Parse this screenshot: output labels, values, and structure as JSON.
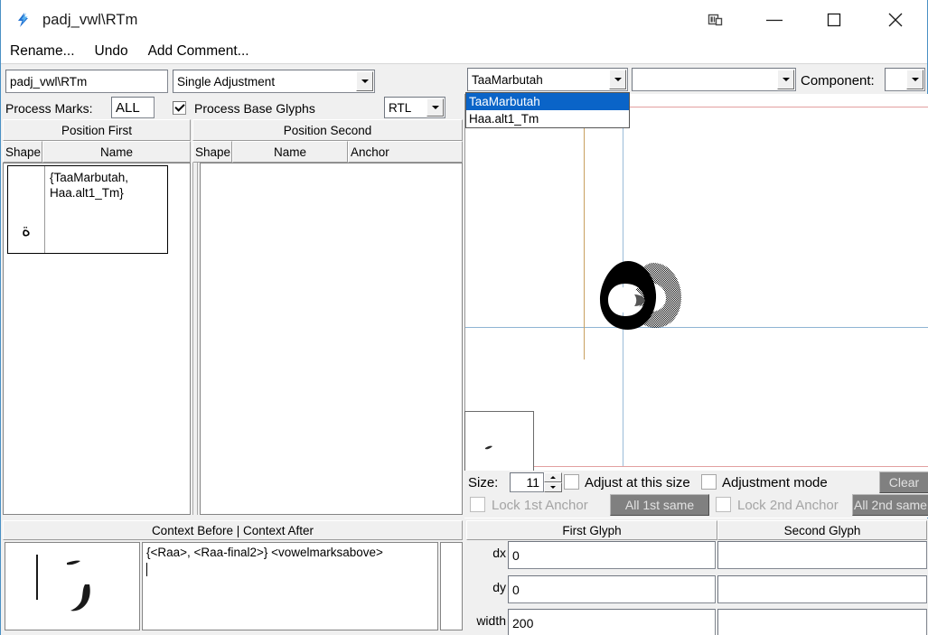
{
  "window": {
    "title": "padj_vwl\\RTm",
    "app_icon": "lightning-bolt-icon",
    "controls": {
      "restore_small": "window-restore-icon",
      "minimize": "—",
      "maximize": "□",
      "close": "✕"
    }
  },
  "menubar": {
    "items": [
      {
        "label": "Rename..."
      },
      {
        "label": "Undo"
      },
      {
        "label": "Add Comment..."
      }
    ]
  },
  "toolbar": {
    "lookup_name": "padj_vwl\\RTm",
    "adjustment_type": "Single Adjustment",
    "process_marks_label": "Process Marks:",
    "process_marks_value": "ALL",
    "process_base_glyphs_label": "Process Base Glyphs",
    "process_base_glyphs_checked": true,
    "direction": "RTL",
    "glyph_combo_value": "TaaMarbutah",
    "second_combo_value": "",
    "component_label": "Component:",
    "component_value": ""
  },
  "dropdown": {
    "open": true,
    "items": [
      {
        "label": "TaaMarbutah",
        "selected": true
      },
      {
        "label": "Haa.alt1_Tm",
        "selected": false
      }
    ]
  },
  "table": {
    "group_headers": [
      {
        "label": "Position First"
      },
      {
        "label": "Position Second"
      }
    ],
    "columns_first": [
      {
        "label": "Shape"
      },
      {
        "label": "Name"
      }
    ],
    "columns_second": [
      {
        "label": "Shape"
      },
      {
        "label": "Name"
      },
      {
        "label": "Anchor"
      }
    ],
    "rows_first": [
      {
        "shape": "ة",
        "name": "{TaaMarbutah,\nHaa.alt1_Tm}"
      }
    ],
    "rows_second": []
  },
  "canvas": {
    "guides": {
      "top_line_color": "#e2a0a0",
      "baseline_color": "#8fb4d4",
      "bottom_line_color": "#e2a0a0",
      "advance_color": "#c8a060",
      "origin_color": "#9bbcd8"
    },
    "first_glyph_color": "#000000",
    "second_glyph_color": "#555555"
  },
  "size_row": {
    "size_label": "Size:",
    "size_value": "11",
    "adjust_at_this_size_label": "Adjust at this size",
    "adjust_at_this_size_checked": false,
    "adjustment_mode_label": "Adjustment mode",
    "adjustment_mode_checked": false,
    "clear_label": "Clear"
  },
  "lock_row": {
    "lock_1st_anchor_label": "Lock 1st Anchor",
    "lock_1st_anchor_checked": false,
    "all_1st_same_label": "All 1st same",
    "lock_2nd_anchor_label": "Lock 2nd Anchor",
    "lock_2nd_anchor_checked": false,
    "all_2nd_same_label": "All 2nd same"
  },
  "context": {
    "header": "Context Before | Context After",
    "text": "{<Raa>, <Raa-final2>} <vowelmarksabove>"
  },
  "glyph_fields": {
    "headers": [
      {
        "label": "First Glyph"
      },
      {
        "label": "Second Glyph"
      }
    ],
    "rows": [
      {
        "label": "dx",
        "first": "0",
        "second": ""
      },
      {
        "label": "dy",
        "first": "0",
        "second": ""
      },
      {
        "label": "width",
        "first": "200",
        "second": ""
      }
    ]
  }
}
